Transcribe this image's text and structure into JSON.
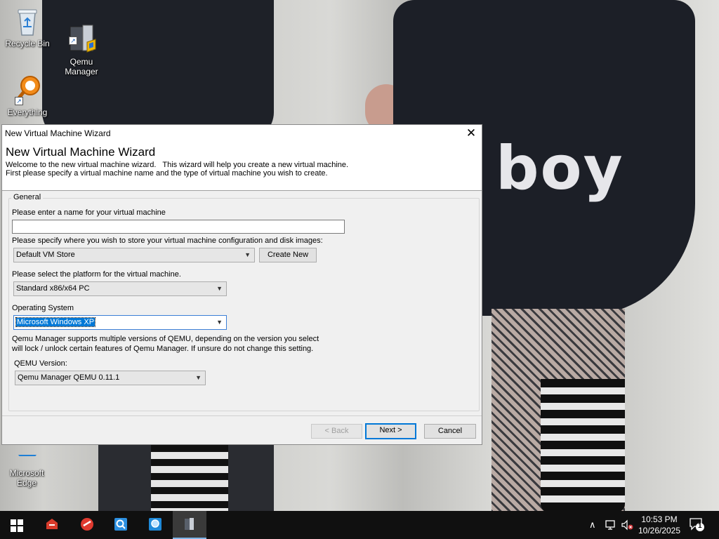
{
  "desktop": {
    "wallpaper_text": "boy",
    "icons": [
      {
        "label": "Recycle Bin"
      },
      {
        "label": "Qemu\nManager"
      },
      {
        "label": "Everything"
      },
      {
        "label": "Microsoft\nEdge"
      }
    ]
  },
  "wizard": {
    "window_title": "New Virtual Machine Wizard",
    "heading": "New Virtual Machine Wizard",
    "description_line1": "Welcome to the new virtual machine wizard.   This wizard will help you create a new virtual machine.",
    "description_line2": "First please specify a virtual machine name and the type of virtual machine you wish to create.",
    "group_label": "General",
    "name_label": "Please enter a name for your virtual machine",
    "name_value": "",
    "store_label": "Please specify where you wish to store your virtual machine configuration and disk images:",
    "store_value": "Default VM Store",
    "create_new_label": "Create New",
    "platform_label": "Please select the platform for the virtual machine.",
    "platform_value": "Standard x86/x64 PC",
    "os_label": "Operating System",
    "os_value": "Microsoft Windows XP",
    "qemu_note_line1": "Qemu Manager supports multiple versions of QEMU, depending on the version you select",
    "qemu_note_line2": "will lock / unlock certain features of Qemu Manager. If unsure do not change this setting.",
    "qemu_version_label": "QEMU Version:",
    "qemu_version_value": "Qemu Manager QEMU 0.11.1",
    "back_label": "< Back",
    "next_label": "Next >",
    "cancel_label": "Cancel"
  },
  "taskbar": {
    "time": "10:53 PM",
    "date": "10/26/2025",
    "notification_count": "1"
  },
  "colors": {
    "accent": "#0078d7",
    "taskbar": "#101010"
  }
}
